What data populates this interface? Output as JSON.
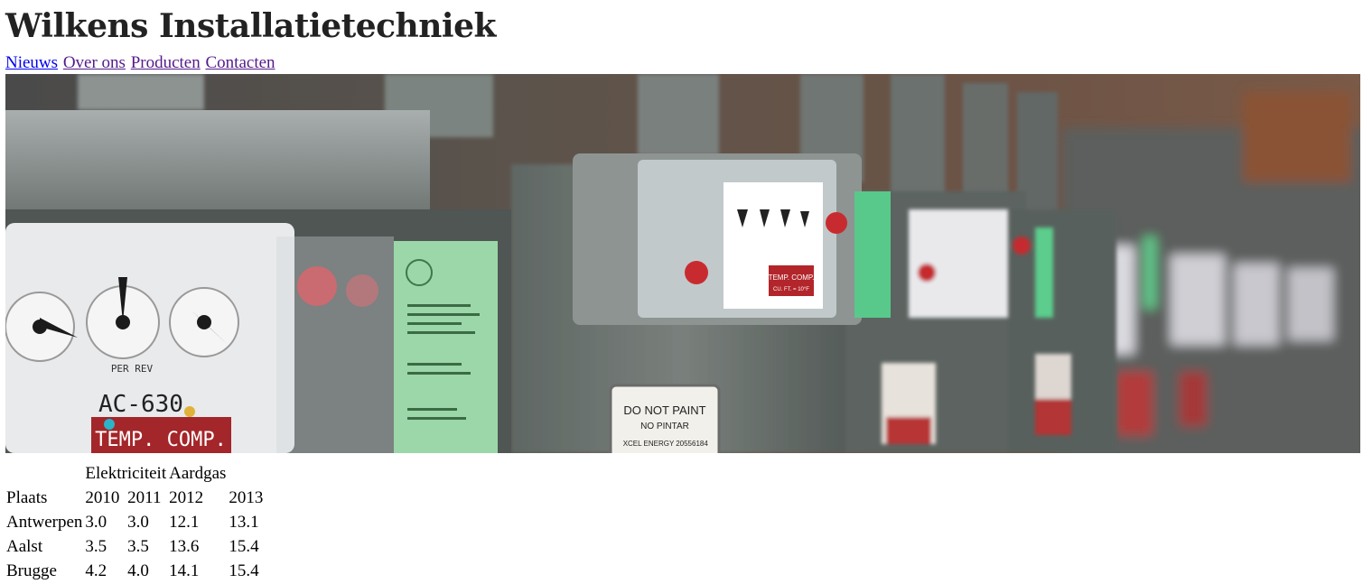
{
  "site": {
    "title": "Wilkens Installatietechniek"
  },
  "nav": [
    {
      "label": "Nieuws"
    },
    {
      "label": "Over ons"
    },
    {
      "label": "Producten"
    },
    {
      "label": "Contacten"
    }
  ],
  "banner": {
    "meter_label": "AC-630",
    "temp_label": "TEMP. COMP.",
    "temp_label_small": "TEMP. COMP.",
    "temp_label_small_sub": "CU. FT. = 10°F",
    "per_rev": "PER REV",
    "do_not_paint": "DO NOT PAINT",
    "no_pintar": "NO PINTAR",
    "xcel": "XCEL ENERGY",
    "serial": "20556184"
  },
  "table": {
    "group_headers": [
      "Elektriciteit",
      "Aardgas"
    ],
    "place_header": "Plaats",
    "years": [
      "2010",
      "2011",
      "2012",
      "2013"
    ],
    "rows": [
      {
        "place": "Antwerpen",
        "values": [
          "3.0",
          "3.0",
          "12.1",
          "13.1"
        ]
      },
      {
        "place": "Aalst",
        "values": [
          "3.5",
          "3.5",
          "13.6",
          "15.4"
        ]
      },
      {
        "place": "Brugge",
        "values": [
          "4.2",
          "4.0",
          "14.1",
          "15.4"
        ]
      }
    ]
  }
}
